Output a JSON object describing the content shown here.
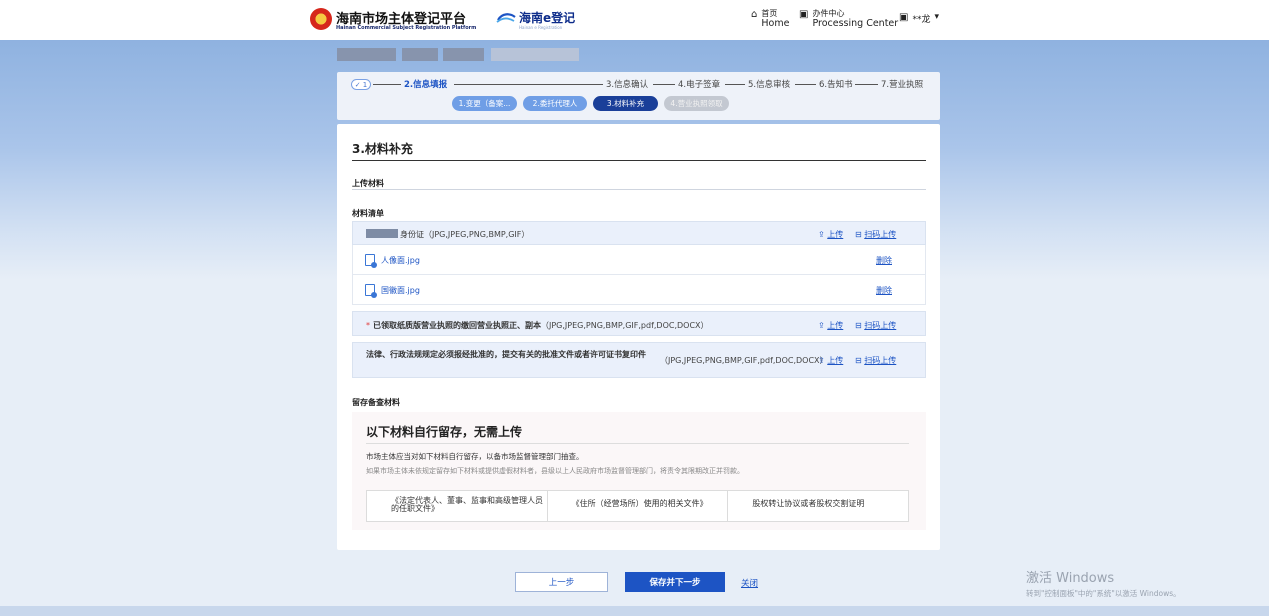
{
  "header": {
    "platform_title": "海南市场主体登记平台",
    "platform_subtitle": "Hainan Commercial Subject Registration Platform",
    "brand2": "海南e登记",
    "brand2_sub": "Hainan e Registration",
    "nav": {
      "home_cn": "首页",
      "home_en": "Home",
      "center_cn": "办件中心",
      "center_en": "Processing Center",
      "user": "**龙"
    }
  },
  "steps": {
    "done_mark": "✓ 1",
    "items": [
      "2.信息填报",
      "3.信息确认",
      "4.电子签章",
      "5.信息审核",
      "6.告知书",
      "7.营业执照"
    ],
    "substeps": [
      "1.变更（备案...",
      "2.委托代理人",
      "3.材料补充",
      "4.营业执照领取"
    ]
  },
  "main": {
    "section_title": "3.材料补充",
    "upload_title": "上传材料",
    "list_title": "材料清单",
    "materials": [
      {
        "name": "身份证",
        "formats": "（JPG,JPEG,PNG,BMP,GIF）",
        "upload": "上传",
        "scan_upload": "扫码上传",
        "files": [
          {
            "name": "人像面.jpg",
            "delete": "删除"
          },
          {
            "name": "国徽面.jpg",
            "delete": "删除"
          }
        ]
      },
      {
        "required_mark": "*",
        "name": "已领取纸质版营业执照的缴回营业执照正、副本",
        "formats": "（JPG,JPEG,PNG,BMP,GIF,pdf,DOC,DOCX）",
        "upload": "上传",
        "scan_upload": "扫码上传"
      },
      {
        "name": "法律、行政法规规定必须报经批准的，提交有关的批准文件或者许可证书复印件",
        "formats": "（JPG,JPEG,PNG,BMP,GIF,pdf,DOC,DOCX）",
        "upload": "上传",
        "scan_upload": "扫码上传"
      }
    ],
    "retain": {
      "title": "留存备查材料",
      "heading": "以下材料自行留存，无需上传",
      "p1": "市场主体应当对如下材料自行留存，以备市场监督管理部门抽查。",
      "p2": "如果市场主体未依规定留存如下材料或提供虚假材料者，县级以上人民政府市场监督管理部门，将责令其限期改正并罚款。",
      "items": [
        "《法定代表人、董事、监事和高级管理人员的任职文件》",
        "《住所（经营场所）使用的相关文件》",
        "股权转让协议或者股权交割证明"
      ]
    }
  },
  "footer": {
    "prev": "上一步",
    "save_next": "保存并下一步",
    "close": "关闭"
  },
  "watermark": {
    "line1": "激活 Windows",
    "line2": "转到\"控制面板\"中的\"系统\"以激活 Windows。"
  }
}
